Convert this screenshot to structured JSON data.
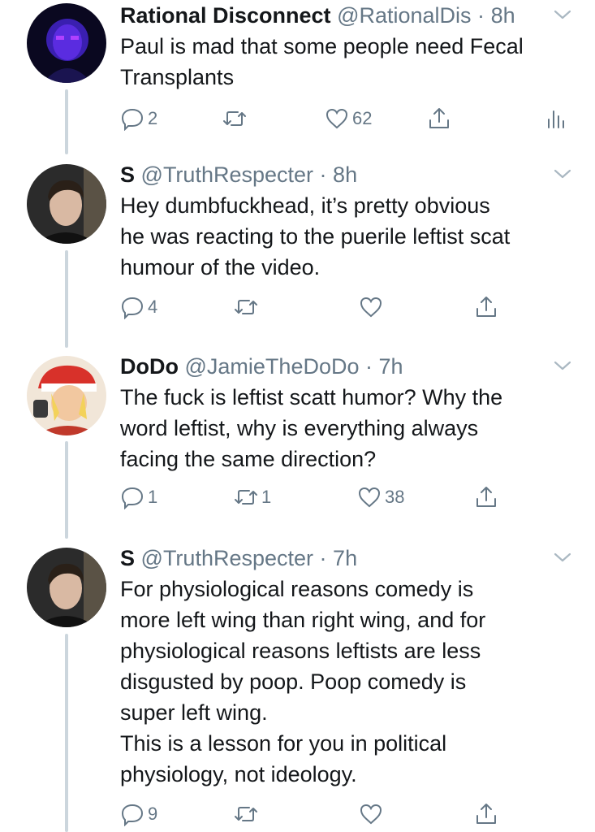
{
  "tweets": [
    {
      "name": "Rational Disconnect",
      "handle": "@RationalDis",
      "dot": "·",
      "time": "8h",
      "lines": [
        "Paul is mad that some people need Fecal",
        "Transplants"
      ],
      "replies": "2",
      "retweets": "",
      "likes": "62",
      "has_analytics": true
    },
    {
      "name": "S",
      "handle": "@TruthRespecter",
      "dot": "·",
      "time": "8h",
      "lines": [
        "Hey dumbfuckhead, it’s pretty obvious",
        "he was reacting to the puerile leftist scat",
        "humour of the video."
      ],
      "replies": "4",
      "retweets": "",
      "likes": "",
      "has_analytics": false
    },
    {
      "name": "DoDo",
      "handle": "@JamieTheDoDo",
      "dot": "·",
      "time": "7h",
      "lines": [
        "The fuck is leftist scatt humor? Why the",
        "word leftist, why is everything always",
        "facing the same direction?"
      ],
      "replies": "1",
      "retweets": "1",
      "likes": "38",
      "has_analytics": false
    },
    {
      "name": "S",
      "handle": "@TruthRespecter",
      "dot": "·",
      "time": "7h",
      "lines": [
        "For physiological reasons comedy is",
        "more left wing than right wing, and for",
        "physiological reasons leftists are less",
        "disgusted by poop. Poop comedy is",
        "super left wing.",
        "This is a lesson for you in political",
        "physiology, not ideology."
      ],
      "replies": "9",
      "retweets": "",
      "likes": "",
      "has_analytics": false
    }
  ],
  "colors": {
    "text": "#14171a",
    "secondary": "#657786",
    "thread_line": "#ccd6dd"
  },
  "icons": [
    "reply-icon",
    "retweet-icon",
    "like-icon",
    "share-icon",
    "analytics-icon",
    "chevron-down-icon"
  ]
}
